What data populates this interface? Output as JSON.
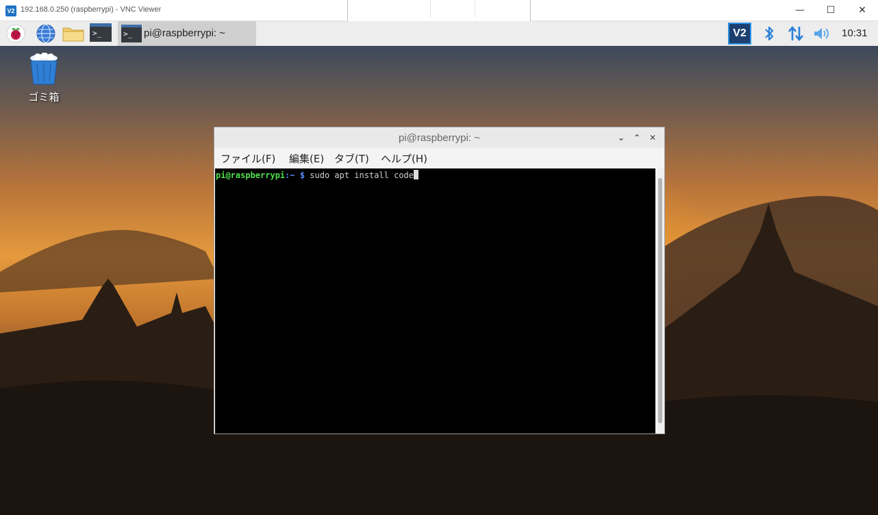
{
  "vnc_window": {
    "title": "192.168.0.250 (raspberrypi) - VNC Viewer",
    "icon": "vnc-viewer-icon",
    "icon_text": "V2",
    "minimize": "—",
    "maximize": "☐",
    "close": "✕"
  },
  "panel": {
    "launchers": [
      "raspberry-menu-icon",
      "web-browser-icon",
      "file-manager-icon",
      "terminal-icon"
    ],
    "launcher_terminal_glyph": ">_",
    "taskbar_item": {
      "label": "pi@raspberrypi: ~",
      "glyph": ">_"
    },
    "tray": {
      "vnc_icon_text": "V2",
      "bluetooth": "bluetooth-icon",
      "network": "network-updown-icon",
      "volume": "volume-icon",
      "clock": "10:31"
    }
  },
  "desktop": {
    "trash_label": "ゴミ箱"
  },
  "terminal": {
    "title": "pi@raspberrypi: ~",
    "menus": [
      "ファイル(F)",
      "編集(E)",
      "タブ(T)",
      "ヘルプ(H)"
    ],
    "prompt_user": "pi@raspberrypi",
    "prompt_path": ":~",
    "prompt_symbol": " $",
    "command": " sudo apt install code",
    "controls": {
      "minimize": "⌄",
      "maximize": "⌃",
      "close": "✕"
    }
  },
  "colors": {
    "prompt_user": "#4ee04e",
    "prompt_path": "#5a8cff",
    "vnc_accent": "#2b90e0",
    "bluetooth": "#2b7fd8"
  }
}
